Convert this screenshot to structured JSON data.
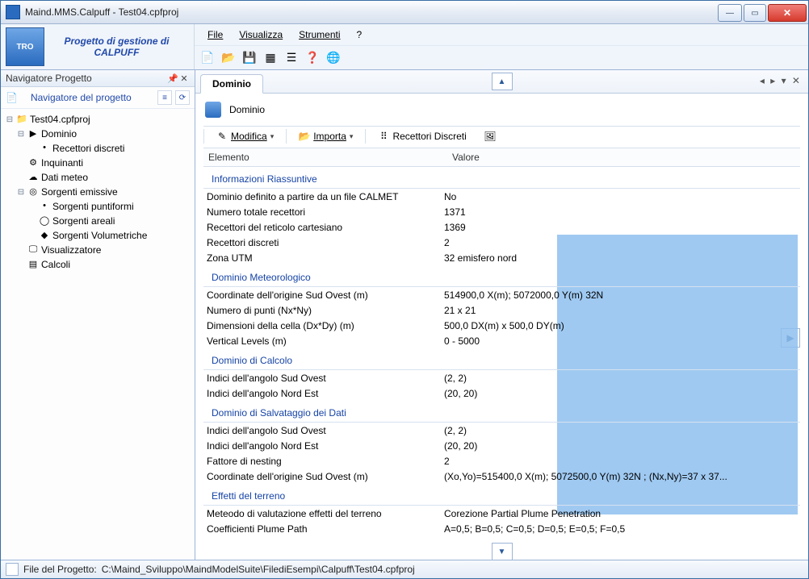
{
  "window": {
    "title": "Maind.MMS.Calpuff - Test04.cpfproj"
  },
  "header": {
    "logo_text": "Progetto di gestione di CALPUFF",
    "logo_badge": "TRO",
    "menu": {
      "file": "File",
      "visualizza": "Visualizza",
      "strumenti": "Strumenti",
      "help": "?"
    }
  },
  "nav": {
    "panel_title": "Navigatore Progetto",
    "subtitle": "Navigatore del progetto"
  },
  "tree": {
    "root": "Test04.cpfproj",
    "n_dominio": "Dominio",
    "n_recettori_discreti": "Recettori discreti",
    "n_inquinanti": "Inquinanti",
    "n_dati_meteo": "Dati meteo",
    "n_sorgenti_emissive": "Sorgenti emissive",
    "n_sorgenti_puntiformi": "Sorgenti puntiformi",
    "n_sorgenti_areali": "Sorgenti areali",
    "n_sorgenti_volumetriche": "Sorgenti Volumetriche",
    "n_visualizzatore": "Visualizzatore",
    "n_calcoli": "Calcoli"
  },
  "tab": {
    "dominio": "Dominio"
  },
  "panel": {
    "title": "Dominio"
  },
  "actions": {
    "modifica": "Modifica",
    "importa": "Importa",
    "recettori": "Recettori Discreti"
  },
  "grid": {
    "col_elemento": "Elemento",
    "col_valore": "Valore"
  },
  "sections": {
    "s1": "Informazioni Riassuntive",
    "s2": "Dominio Meteorologico",
    "s3": "Dominio di Calcolo",
    "s4": "Dominio di Salvataggio dei Dati",
    "s5": "Effetti del terreno"
  },
  "r": {
    "r1a": "Dominio definito a partire da un file CALMET",
    "r1b": "No",
    "r2a": "Numero totale recettori",
    "r2b": "1371",
    "r3a": "Recettori del reticolo cartesiano",
    "r3b": "1369",
    "r4a": "Recettori discreti",
    "r4b": "2",
    "r5a": "Zona UTM",
    "r5b": "32 emisfero nord",
    "r6a": "Coordinate dell'origine Sud Ovest (m)",
    "r6b": "514900,0 X(m); 5072000,0 Y(m) 32N",
    "r7a": "Numero di punti (Nx*Ny)",
    "r7b": "21 x 21",
    "r8a": "Dimensioni della cella (Dx*Dy) (m)",
    "r8b": "500,0 DX(m) x 500,0 DY(m)",
    "r9a": "Vertical Levels (m)",
    "r9b": "0 - 5000",
    "r10a": "Indici dell'angolo Sud Ovest",
    "r10b": "(2, 2)",
    "r11a": "Indici dell'angolo Nord Est",
    "r11b": "(20, 20)",
    "r12a": "Indici dell'angolo Sud Ovest",
    "r12b": "(2, 2)",
    "r13a": "Indici dell'angolo Nord Est",
    "r13b": "(20, 20)",
    "r14a": "Fattore di nesting",
    "r14b": "2",
    "r15a": "Coordinate dell'origine Sud Ovest (m)",
    "r15b": "(Xo,Yo)=515400,0 X(m); 5072500,0 Y(m) 32N ; (Nx,Ny)=37 x 37...",
    "r16a": "Meteodo di valutazione effetti del terreno",
    "r16b": "Corezione Partial Plume Penetration",
    "r17a": "Coefficienti Plume Path",
    "r17b": "A=0,5; B=0,5; C=0,5; D=0,5; E=0,5; F=0,5"
  },
  "status": {
    "label": "File del Progetto:",
    "path": "C:\\Maind_Sviluppo\\MaindModelSuite\\FilediEsempi\\Calpuff\\Test04.cpfproj"
  }
}
